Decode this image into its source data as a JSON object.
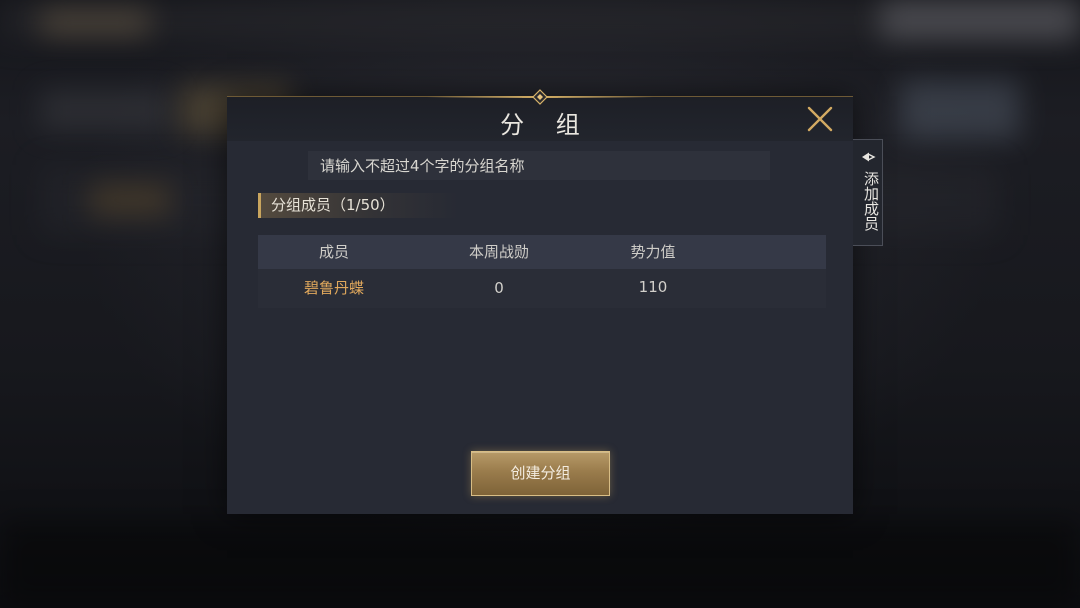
{
  "dialog": {
    "title": "分 组",
    "close_icon": "close-x-icon",
    "name_input": {
      "value": "",
      "placeholder": "请输入不超过4个字的分组名称"
    },
    "section_label": "分组成员（1/50）",
    "table": {
      "headers": [
        "成员",
        "本周战勋",
        "势力值"
      ],
      "rows": [
        {
          "name": "碧鲁丹蝶",
          "weekly_merit": "0",
          "power": "110"
        }
      ]
    },
    "create_button": "创建分组"
  },
  "side_tab": {
    "label": "添加成员",
    "icon": "chevron-left-icon"
  },
  "colors": {
    "accent_gold": "#c9a55e",
    "member_name": "#e0a85c",
    "panel_bg": "#272a34"
  }
}
